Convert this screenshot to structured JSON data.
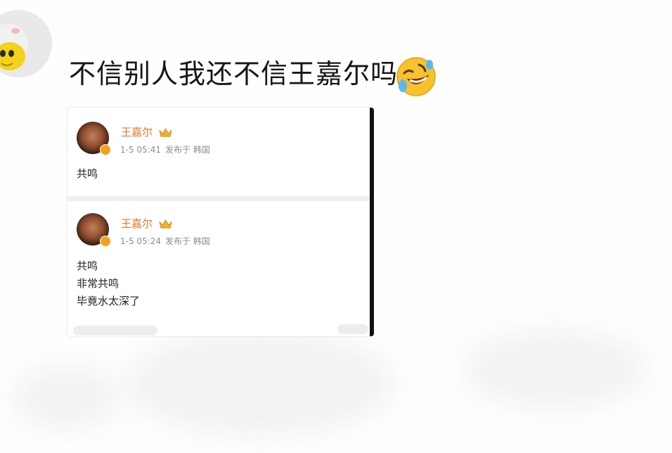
{
  "comment": {
    "text": "不信别人我还不信王嘉尔吗",
    "emoji": "rolling-on-floor-laughing-icon"
  },
  "posts": [
    {
      "author": "王嘉尔",
      "time": "1-5 05:41",
      "location": "发布于 韩国",
      "lines": [
        "共鸣"
      ]
    },
    {
      "author": "王嘉尔",
      "time": "1-5 05:24",
      "location": "发布于 韩国",
      "lines": [
        "共鸣",
        "非常共鸣",
        "毕竟水太深了"
      ]
    }
  ],
  "colors": {
    "author": "#e2792a",
    "meta": "#8d8d8d",
    "badge": "#f2a21b"
  }
}
